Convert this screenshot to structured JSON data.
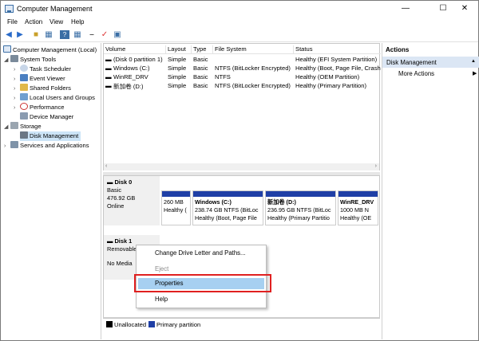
{
  "window": {
    "title": "Computer Management",
    "minimize": "—",
    "maximize": "☐",
    "close": "✕"
  },
  "menu": [
    "File",
    "Action",
    "View",
    "Help"
  ],
  "toolbar": [
    "back-icon",
    "forward-icon",
    "up-folder-icon",
    "show-tree-icon",
    "help-icon",
    "properties-icon",
    "connect-icon",
    "check-icon",
    "view-icon"
  ],
  "tree": {
    "root": "Computer Management (Local)",
    "system_tools": "System Tools",
    "items": [
      "Task Scheduler",
      "Event Viewer",
      "Shared Folders",
      "Local Users and Groups",
      "Performance",
      "Device Manager"
    ],
    "storage": "Storage",
    "disk_management": "Disk Management",
    "services": "Services and Applications"
  },
  "volumes": {
    "headers": [
      "Volume",
      "Layout",
      "Type",
      "File System",
      "Status"
    ],
    "rows": [
      [
        "(Disk 0 partition 1)",
        "Simple",
        "Basic",
        "",
        "Healthy (EFI System Partition)"
      ],
      [
        "Windows (C:)",
        "Simple",
        "Basic",
        "NTFS (BitLocker Encrypted)",
        "Healthy (Boot, Page File, Crash"
      ],
      [
        "WinRE_DRV",
        "Simple",
        "Basic",
        "NTFS",
        "Healthy (OEM Partition)"
      ],
      [
        "新加卷 (D:)",
        "Simple",
        "Basic",
        "NTFS (BitLocker Encrypted)",
        "Healthy (Primary Partition)"
      ]
    ]
  },
  "disk0": {
    "name": "Disk 0",
    "type": "Basic",
    "size": "476.92 GB",
    "state": "Online",
    "partitions": [
      {
        "name": "",
        "size": "260 MB",
        "status": "Healthy ("
      },
      {
        "name": "Windows  (C:)",
        "size": "238.74 GB NTFS (BitLoc",
        "status": "Healthy (Boot, Page File"
      },
      {
        "name": "新加卷  (D:)",
        "size": "236.95 GB NTFS (BitLoc",
        "status": "Healthy (Primary Partitio"
      },
      {
        "name": "WinRE_DRV",
        "size": "1000 MB N",
        "status": "Healthy (OE"
      }
    ]
  },
  "disk1": {
    "name": "Disk 1",
    "type": "Removable",
    "state": "No Media"
  },
  "legend": {
    "unallocated": "Unallocated",
    "primary": "Primary partition",
    "unallocated_color": "#000000",
    "primary_color": "#1f3fa6"
  },
  "actions": {
    "header": "Actions",
    "selected": "Disk Management",
    "more": "More Actions"
  },
  "context_menu": {
    "change_drive": "Change Drive Letter and Paths...",
    "eject": "Eject",
    "properties": "Properties",
    "help": "Help"
  },
  "colors": {
    "highlight": "#a7d0f1",
    "annotation": "#e02020"
  }
}
